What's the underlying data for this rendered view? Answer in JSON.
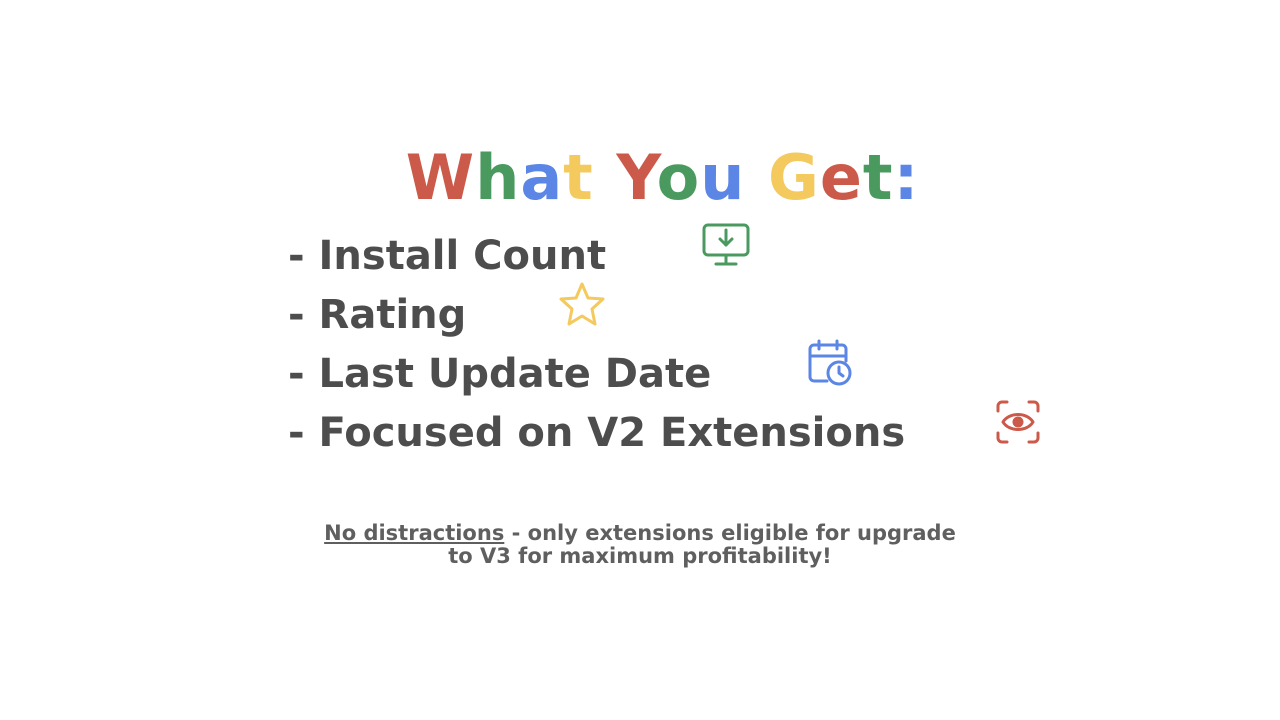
{
  "title": {
    "letters": [
      {
        "ch": "W",
        "color": "#cc5a4a"
      },
      {
        "ch": "h",
        "color": "#4a9a5f"
      },
      {
        "ch": "a",
        "color": "#5b86e5"
      },
      {
        "ch": "t",
        "color": "#f4c95d"
      },
      {
        "ch": " ",
        "color": "#ffffff"
      },
      {
        "ch": "Y",
        "color": "#cc5a4a"
      },
      {
        "ch": "o",
        "color": "#4a9a5f"
      },
      {
        "ch": "u",
        "color": "#5b86e5"
      },
      {
        "ch": " ",
        "color": "#ffffff"
      },
      {
        "ch": "G",
        "color": "#f4c95d"
      },
      {
        "ch": "e",
        "color": "#cc5a4a"
      },
      {
        "ch": "t",
        "color": "#4a9a5f"
      },
      {
        "ch": ":",
        "color": "#5b86e5"
      }
    ]
  },
  "features": [
    {
      "label": "- Install Count",
      "icon": "monitor-download-icon",
      "color": "#4a9a5f"
    },
    {
      "label": "- Rating",
      "icon": "star-icon",
      "color": "#f4c95d"
    },
    {
      "label": "- Last Update Date",
      "icon": "calendar-clock-icon",
      "color": "#5b86e5"
    },
    {
      "label": "- Focused on V2 Extensions",
      "icon": "eye-focus-icon",
      "color": "#cc5a4a"
    }
  ],
  "footer": {
    "underlined": "No distractions",
    "rest": " - only extensions eligible for upgrade",
    "line2": "to V3 for maximum profitability!"
  }
}
